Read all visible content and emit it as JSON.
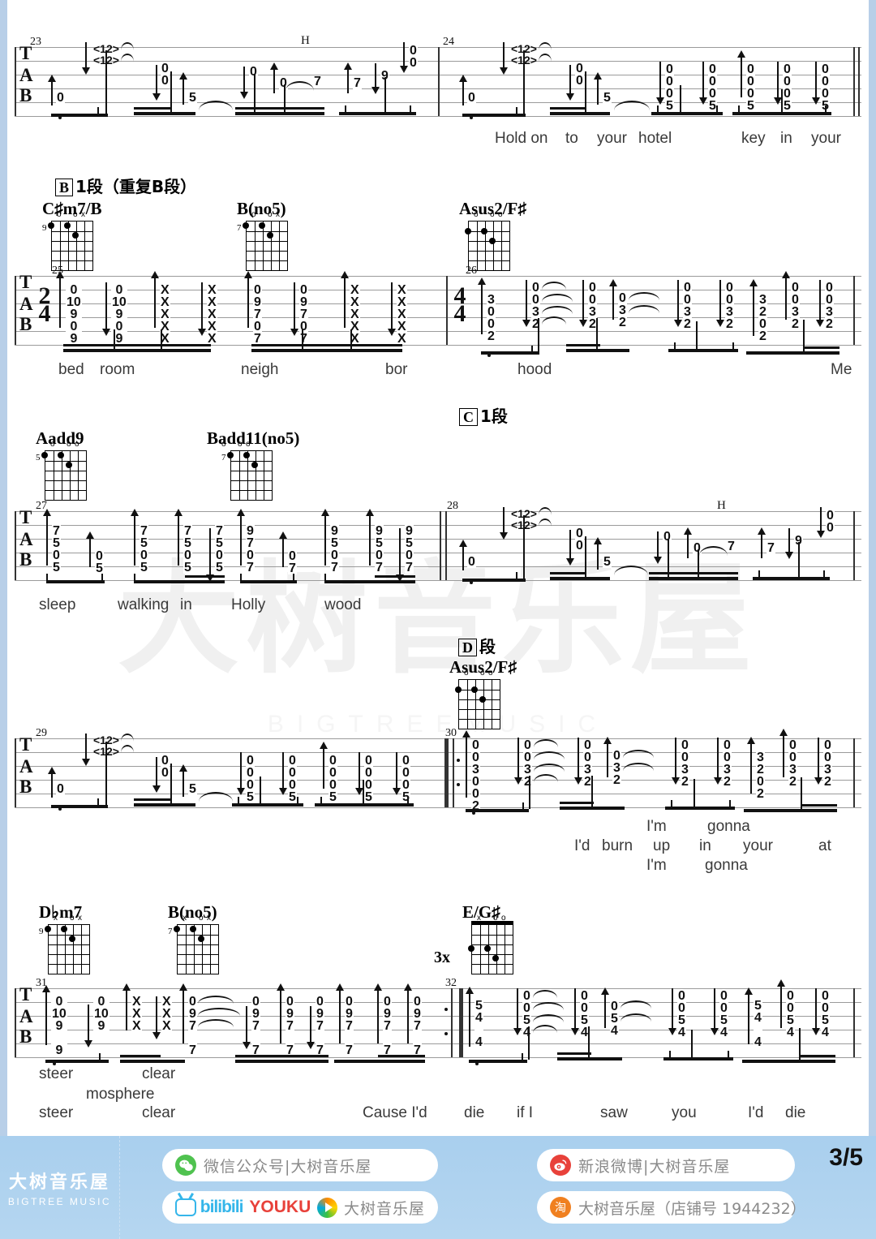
{
  "page": {
    "number": "3/5",
    "watermark_cn": "大树音乐屋",
    "watermark_en": "BIGTREEMUSIC"
  },
  "section_markers": [
    {
      "id": "B",
      "letter": "B",
      "text": "1段（重复B段）"
    },
    {
      "id": "C",
      "letter": "C",
      "text": "1段"
    },
    {
      "id": "D",
      "letter": "D",
      "text": "段"
    }
  ],
  "chords": [
    {
      "name": "C♯m7/B",
      "fret": "9",
      "marks": "o  ox"
    },
    {
      "name": "B(no5)",
      "fret": "7",
      "marks": "o  ox"
    },
    {
      "name": "Asus2/F♯",
      "fret": "",
      "marks": "o  oo"
    },
    {
      "name": "Aadd9",
      "fret": "5",
      "marks": "o  oo"
    },
    {
      "name": "Badd11(no5)",
      "fret": "7",
      "marks": "o  oo"
    },
    {
      "name": "Asus2/F♯",
      "fret": "",
      "marks": "o  oo"
    },
    {
      "name": "D♭m7",
      "fret": "9",
      "marks": "x  ox"
    },
    {
      "name": "B(no5)",
      "fret": "7",
      "marks": "x  ox"
    },
    {
      "name": "E/G♯",
      "fret": "",
      "marks": "x  oo",
      "repeat": "3x"
    }
  ],
  "staff_label": {
    "t": "T",
    "a": "A",
    "b": "B"
  },
  "time_signatures": [
    {
      "num": "2",
      "den": "4"
    },
    {
      "num": "4",
      "den": "4"
    }
  ],
  "measures": [
    {
      "number": "23"
    },
    {
      "number": "24"
    },
    {
      "number": "25"
    },
    {
      "number": "26"
    },
    {
      "number": "27"
    },
    {
      "number": "28"
    },
    {
      "number": "29"
    },
    {
      "number": "30"
    },
    {
      "number": "31"
    },
    {
      "number": "32"
    }
  ],
  "markers": {
    "twelve": "<12>",
    "hammer": "H"
  },
  "lyrics": {
    "system1": [
      "Hold on",
      "to",
      "your",
      "hotel",
      "key",
      "in",
      "your"
    ],
    "system2": [
      "bed",
      "room",
      "neigh",
      "bor",
      "hood",
      "Me"
    ],
    "system3": [
      "sleep",
      "walking",
      "in",
      "Holly",
      "wood"
    ],
    "system4_line1": [
      "I'm",
      "gonna"
    ],
    "system4_line2": [
      "I'd",
      "burn",
      "up",
      "in",
      "your",
      "at"
    ],
    "system4_line3": [
      "I'm",
      "gonna"
    ],
    "system5_line1": [
      "steer",
      "clear"
    ],
    "system5_line2": [
      "mosphere"
    ],
    "system5_line3": [
      "steer",
      "clear",
      "Cause I'd",
      "die",
      "if I",
      "saw",
      "you",
      "I'd",
      "die"
    ]
  },
  "tab_notes": {
    "m23": [
      "0",
      "<12>",
      "0\n0",
      "5",
      "0",
      "0",
      "7",
      "7",
      "9",
      "0\n0"
    ],
    "m24": [
      "0",
      "<12>",
      "0\n0",
      "5",
      "0\n0\n0\n5",
      "0\n0\n0\n5",
      "0\n0\n0\n5",
      "0\n0\n0\n5",
      "0\n0\n0\n5"
    ],
    "m25": [
      "0\n10\n9\n0\n9",
      "0\n10\n9\n0\n9",
      "X\nX\nX\nX\nX",
      "X\nX\nX\nX\nX",
      "0\n9\n7\n0\n7",
      "0\n9\n7\n0\n7",
      "X\nX\nX\nX\nX",
      "X\nX\nX\nX\nX"
    ],
    "m26": [
      "3\n0\n0\n2",
      "0\n0\n3\n2",
      "0\n0\n3\n2",
      "0\n3\n2",
      "0\n0\n3\n2",
      "0\n0\n3\n2",
      "3\n2\n0\n2",
      "0\n0\n3\n2",
      "0\n0\n3\n2"
    ],
    "m27": [
      "7\n5\n0\n5",
      "0\n5",
      "7\n5\n0\n5",
      "7\n5\n0\n5",
      "7\n5\n0\n5",
      "9\n7\n0\n7",
      "0\n7",
      "9\n5\n0\n7",
      "9\n5\n0\n7",
      "9\n5\n0\n7"
    ],
    "m28": [
      "0",
      "<12>",
      "0\n0",
      "5",
      "0",
      "0",
      "7",
      "7",
      "9",
      "0\n0"
    ],
    "m29": [
      "0",
      "<12>",
      "0\n0",
      "5",
      "0\n0\n0\n5",
      "0\n0\n0\n5",
      "0\n0\n0\n5",
      "0\n0\n0\n5",
      "0\n0\n0\n5"
    ],
    "m30": [
      "0\n0\n3\n0\n0\n2",
      "0\n0\n3\n2",
      "0\n0\n3\n2",
      "0\n3\n2",
      "0\n0\n3\n2",
      "0\n0\n3\n2",
      "3\n2\n0\n2",
      "0\n0\n3\n2",
      "0\n0\n3\n2"
    ],
    "m31": [
      "0\n10\n9\n9",
      "0\n10\n9",
      "X\nX\nX",
      "X\nX\nX",
      "0\n9\n7\n7",
      "0\n9\n7\n7",
      "0\n9\n7\n7",
      "0\n9\n7\n7",
      "0\n9\n7\n7",
      "0\n9\n7\n7",
      "0\n9\n7\n7"
    ],
    "m32": [
      "5\n4\n4",
      "0\n0\n5\n4",
      "0\n0\n5\n4",
      "0\n5\n4",
      "0\n0\n5\n4",
      "0\n0\n5\n4",
      "5\n4\n4",
      "0\n0\n5\n4",
      "0\n0\n5\n4"
    ]
  },
  "footer": {
    "brand_cn": "大树音乐屋",
    "brand_en": "BIGTREE MUSIC",
    "links": [
      {
        "icon": "wechat-icon",
        "label": "微信公众号|大树音乐屋"
      },
      {
        "icon": "bilibili-youku-icon",
        "label": "大树音乐屋",
        "bili": "bilibili",
        "youku": "YOUKU"
      },
      {
        "icon": "weibo-icon",
        "label": "新浪微博|大树音乐屋"
      },
      {
        "icon": "taobao-icon",
        "label": "大树音乐屋（店铺号 1944232）"
      }
    ]
  }
}
